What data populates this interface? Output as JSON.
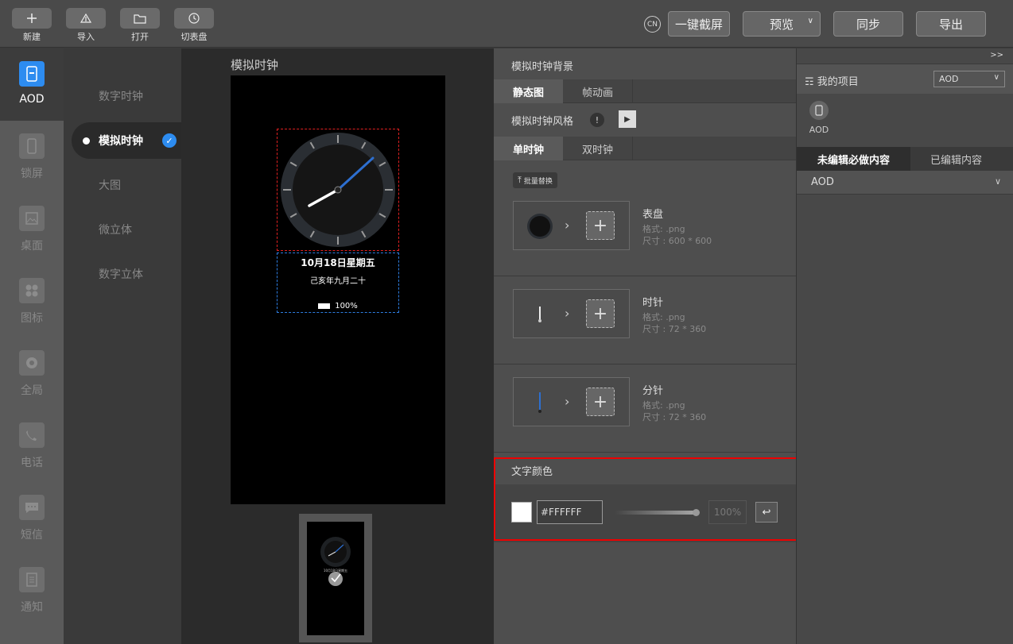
{
  "toolbar": {
    "tools": [
      {
        "label": "新建",
        "icon": "plus-icon"
      },
      {
        "label": "导入",
        "icon": "import-icon"
      },
      {
        "label": "打开",
        "icon": "folder-icon"
      },
      {
        "label": "切表盘",
        "icon": "watch-icon"
      }
    ],
    "lang_badge": "CN",
    "screenshot_label": "一键截屏",
    "preview_label": "预览",
    "sync_label": "同步",
    "export_label": "导出"
  },
  "iconbar": {
    "items": [
      {
        "label": "AOD",
        "icon": "aod-icon",
        "active": true
      },
      {
        "label": "锁屏",
        "icon": "lock-screen-icon"
      },
      {
        "label": "桌面",
        "icon": "desktop-icon"
      },
      {
        "label": "图标",
        "icon": "icons-icon"
      },
      {
        "label": "全局",
        "icon": "global-icon"
      },
      {
        "label": "电话",
        "icon": "phone-icon"
      },
      {
        "label": "短信",
        "icon": "message-icon"
      },
      {
        "label": "通知",
        "icon": "notification-icon"
      }
    ]
  },
  "submenu": {
    "items": [
      {
        "label": "数字时钟"
      },
      {
        "label": "模拟时钟",
        "active": true
      },
      {
        "label": "大图"
      },
      {
        "label": "微立体"
      },
      {
        "label": "数字立体"
      }
    ]
  },
  "preview": {
    "title": "模拟时钟",
    "date": "10月18日星期五",
    "lunar": "己亥年九月二十",
    "battery": "100%",
    "thumb_caption": "10月18日星期五"
  },
  "props": {
    "title": "模拟时钟背景",
    "bg_tabs": [
      "静态图",
      "帧动画"
    ],
    "style_label": "模拟时钟风格",
    "clock_tabs": [
      "单时钟",
      "双时钟"
    ],
    "batch_label": "批量替换",
    "assets": [
      {
        "name": "表盘",
        "format": "格式: .png",
        "size": "尺寸 : 600 * 600"
      },
      {
        "name": "时针",
        "format": "格式: .png",
        "size": "尺寸 : 72 * 360"
      },
      {
        "name": "分针",
        "format": "格式: .png",
        "size": "尺寸 : 72 * 360"
      }
    ],
    "text_color": {
      "title": "文字颜色",
      "hex": "#FFFFFF",
      "opacity": "100%",
      "opacity_value": 1.0
    }
  },
  "project": {
    "collapse": ">>",
    "title": "☶ 我的项目",
    "select_value": "AOD",
    "item_label": "AOD",
    "tabs": [
      "未编辑必做内容",
      "已编辑内容"
    ],
    "dropdown_label": "AOD"
  },
  "colors": {
    "accent": "#2d8cf0",
    "minute_hand": "#2d6fd0",
    "highlight": "#e00000"
  }
}
